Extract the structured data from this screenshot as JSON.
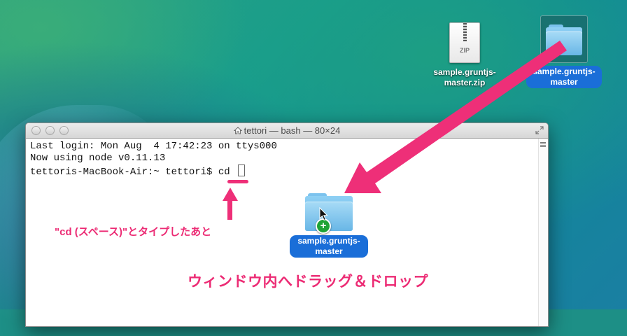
{
  "desktop": {
    "zip_file": {
      "icon": "zip-file-icon",
      "badge": "ZIP",
      "label": "sample.gruntjs-master.zip"
    },
    "folder": {
      "icon": "folder-icon",
      "label": "sample.gruntjs-master"
    }
  },
  "terminal": {
    "title": "tettori — bash — 80×24",
    "lines": [
      "Last login: Mon Aug  4 17:42:23 on ttys000",
      "Now using node v0.11.13",
      "tettoris-MacBook-Air:~ tettori$ cd "
    ]
  },
  "annotations": {
    "cd_note": "\"cd (スペース)\"とタイプしたあと",
    "drag_note": "ウィンドウ内へドラッグ＆ドロップ",
    "accent_color": "#ec2b74"
  },
  "drag": {
    "folder_label": "sample.gruntjs-master",
    "badge": "+"
  }
}
